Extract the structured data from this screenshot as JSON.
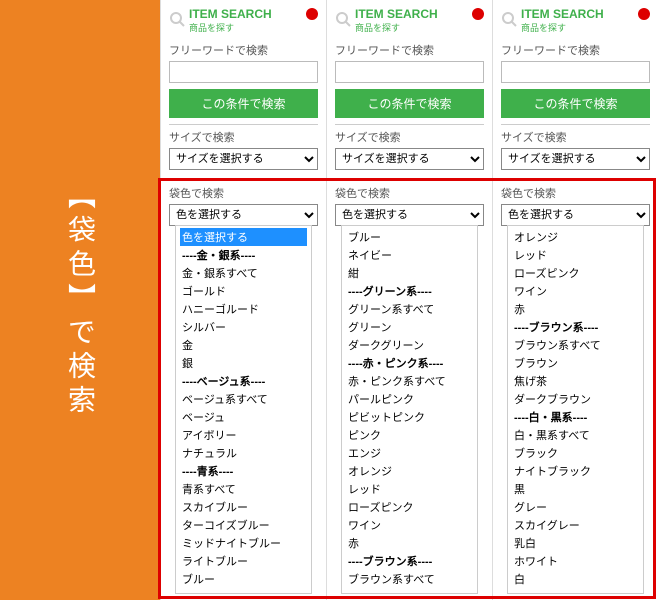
{
  "sidebar": {
    "title": "【袋色】で検索"
  },
  "item_search": {
    "title": "ITEM SEARCH",
    "sub": "商品を探す"
  },
  "labels": {
    "freeword": "フリーワードで検索",
    "search_btn": "この条件で検索",
    "size_search": "サイズで検索",
    "size_placeholder": "サイズを選択する",
    "color_search": "袋色で検索",
    "color_placeholder": "色を選択する"
  },
  "panel1_color_options": [
    {
      "label": "色を選択する",
      "selected": true
    },
    {
      "label": "----金・銀系----",
      "group": true
    },
    {
      "label": "金・銀系すべて"
    },
    {
      "label": "ゴールド"
    },
    {
      "label": "ハニーゴルード"
    },
    {
      "label": "シルバー"
    },
    {
      "label": "金"
    },
    {
      "label": "銀"
    },
    {
      "label": "----ベージュ系----",
      "group": true
    },
    {
      "label": "ベージュ系すべて"
    },
    {
      "label": "ベージュ"
    },
    {
      "label": "アイボリー"
    },
    {
      "label": "ナチュラル"
    },
    {
      "label": "----青系----",
      "group": true
    },
    {
      "label": "青系すべて"
    },
    {
      "label": "スカイブルー"
    },
    {
      "label": "ターコイズブルー"
    },
    {
      "label": "ミッドナイトブルー"
    },
    {
      "label": "ライトブルー"
    },
    {
      "label": "ブルー"
    }
  ],
  "panel2_color_options": [
    {
      "label": "ブルー"
    },
    {
      "label": "ネイビー"
    },
    {
      "label": "紺"
    },
    {
      "label": "----グリーン系----",
      "group": true
    },
    {
      "label": "グリーン系すべて"
    },
    {
      "label": "グリーン"
    },
    {
      "label": "ダークグリーン"
    },
    {
      "label": "----赤・ピンク系----",
      "group": true
    },
    {
      "label": "赤・ピンク系すべて"
    },
    {
      "label": "パールピンク"
    },
    {
      "label": "ピビットピンク"
    },
    {
      "label": "ピンク"
    },
    {
      "label": "エンジ"
    },
    {
      "label": "オレンジ"
    },
    {
      "label": "レッド"
    },
    {
      "label": "ローズピンク"
    },
    {
      "label": "ワイン"
    },
    {
      "label": "赤"
    },
    {
      "label": "----ブラウン系----",
      "group": true
    },
    {
      "label": "ブラウン系すべて"
    }
  ],
  "panel3_color_options": [
    {
      "label": "オレンジ"
    },
    {
      "label": "レッド"
    },
    {
      "label": "ローズピンク"
    },
    {
      "label": "ワイン"
    },
    {
      "label": "赤"
    },
    {
      "label": "----ブラウン系----",
      "group": true
    },
    {
      "label": "ブラウン系すべて"
    },
    {
      "label": "ブラウン"
    },
    {
      "label": "焦げ茶"
    },
    {
      "label": "ダークブラウン"
    },
    {
      "label": "----白・黒系----",
      "group": true
    },
    {
      "label": "白・黒系すべて"
    },
    {
      "label": "ブラック"
    },
    {
      "label": "ナイトブラック"
    },
    {
      "label": "黒"
    },
    {
      "label": "グレー"
    },
    {
      "label": "スカイグレー"
    },
    {
      "label": "乳白"
    },
    {
      "label": "ホワイト"
    },
    {
      "label": "白"
    }
  ]
}
